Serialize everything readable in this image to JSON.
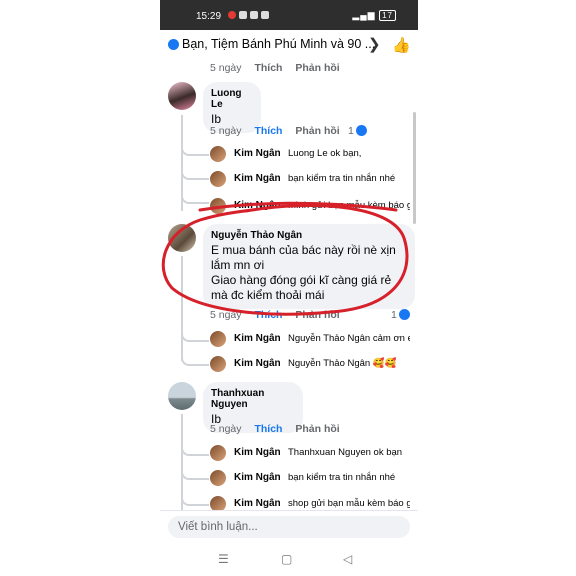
{
  "status": {
    "time": "15:29",
    "right": "··· ",
    "battery": "17"
  },
  "header": {
    "title": "Bạn, Tiệm Bánh Phú Minh và 90 ...",
    "chevron": "❯",
    "like": "👍"
  },
  "top_meta": {
    "time": "5 ngày",
    "like": "Thích",
    "reply": "Phản hồi"
  },
  "comments": [
    {
      "name": "Luong Le",
      "text": "Ib",
      "meta": {
        "time": "5 ngày",
        "like": "Thích",
        "reply": "Phản hồi",
        "count": "1"
      },
      "replies": [
        {
          "name": "Kim Ngân",
          "text": "Luong Le ok bạn,"
        },
        {
          "name": "Kim Ngân",
          "text": "bạn kiểm tra tin nhắn nhé"
        },
        {
          "name": "Kim Ngân",
          "text": "mình gửi bạn mẫu kèm báo gi..."
        }
      ]
    },
    {
      "name": "Nguyễn Thảo Ngân",
      "text": "E mua bánh của bác này rồi nè xịn lắm mn ơi\nGiao hàng đóng gói kĩ càng giá rẻ mà đc kiểm thoải mái",
      "meta": {
        "time": "5 ngày",
        "like": "Thích",
        "reply": "Phản hồi",
        "count": "1"
      },
      "replies": [
        {
          "name": "Kim Ngân",
          "text": "Nguyễn Thảo Ngân cảm ơn e..."
        },
        {
          "name": "Kim Ngân",
          "text": "Nguyễn Thảo Ngân 🥰🥰"
        }
      ]
    },
    {
      "name": "Thanhxuan Nguyen",
      "text": "Ib",
      "meta": {
        "time": "5 ngày",
        "like": "Thích",
        "reply": "Phản hồi"
      },
      "replies": [
        {
          "name": "Kim Ngân",
          "text": "Thanhxuan Nguyen ok bạn"
        },
        {
          "name": "Kim Ngân",
          "text": "bạn kiểm tra tin nhắn nhé"
        },
        {
          "name": "Kim Ngân",
          "text": "shop gửi bạn mẫu kèm báo gi..."
        }
      ]
    }
  ],
  "input": {
    "placeholder": "Viết bình luận..."
  },
  "nav": {
    "menu": "☰",
    "home": "▢",
    "back": "◁"
  },
  "colors": {
    "accent": "#1877f2",
    "annotation": "#d6202a"
  }
}
